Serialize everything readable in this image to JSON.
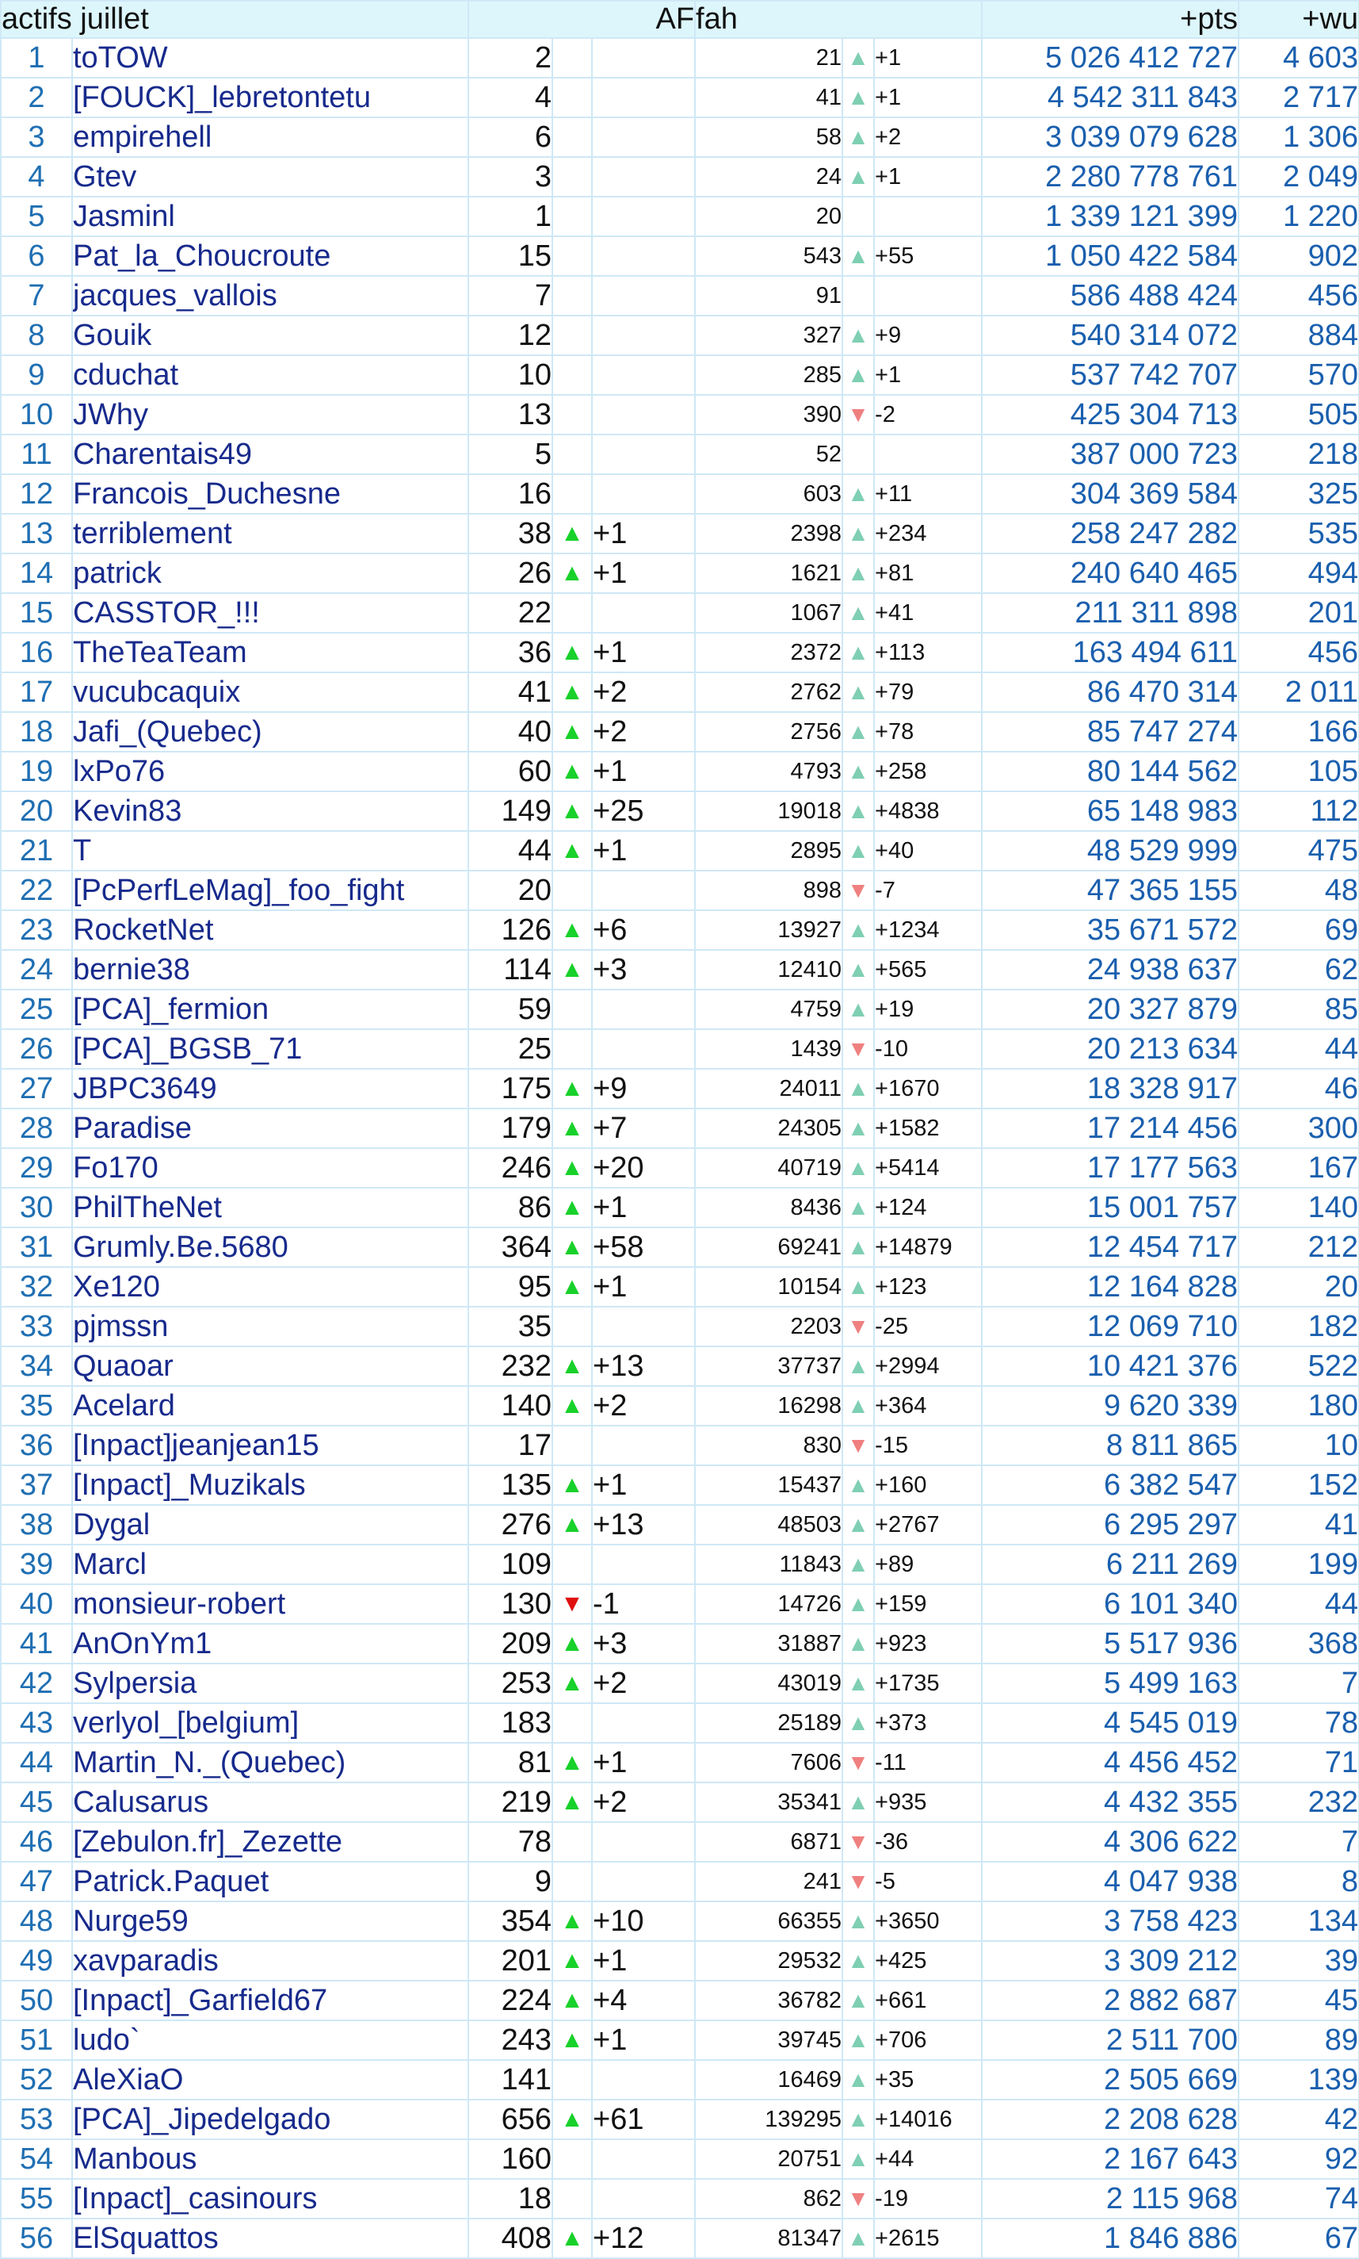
{
  "header": {
    "title": "actifs juillet",
    "af": "AF",
    "fah": "fah",
    "pts": "+pts",
    "wu": "+wu"
  },
  "icons": {
    "up": "triangle-up-icon",
    "down": "triangle-down-icon"
  },
  "colors": {
    "up_big": "#18d12a",
    "down_big": "#e01010",
    "up_small": "#7fcfb3",
    "down_small": "#f08080",
    "header_bg": "#ddf6fb",
    "name_text": "#172a8c",
    "points_text": "#1a5fae"
  },
  "rows": [
    {
      "rank": "1",
      "name": "toTOW",
      "af": "2",
      "af_arrow": "",
      "af_delta": "",
      "fah": "21",
      "fah_arrow": "up",
      "fah_delta": "+1",
      "pts": "5 026 412 727",
      "wu": "4 603"
    },
    {
      "rank": "2",
      "name": "[FOUCK]_lebretontetu",
      "af": "4",
      "af_arrow": "",
      "af_delta": "",
      "fah": "41",
      "fah_arrow": "up",
      "fah_delta": "+1",
      "pts": "4 542 311 843",
      "wu": "2 717"
    },
    {
      "rank": "3",
      "name": "empirehell",
      "af": "6",
      "af_arrow": "",
      "af_delta": "",
      "fah": "58",
      "fah_arrow": "up",
      "fah_delta": "+2",
      "pts": "3 039 079 628",
      "wu": "1 306"
    },
    {
      "rank": "4",
      "name": "Gtev",
      "af": "3",
      "af_arrow": "",
      "af_delta": "",
      "fah": "24",
      "fah_arrow": "up",
      "fah_delta": "+1",
      "pts": "2 280 778 761",
      "wu": "2 049"
    },
    {
      "rank": "5",
      "name": "Jasminl",
      "af": "1",
      "af_arrow": "",
      "af_delta": "",
      "fah": "20",
      "fah_arrow": "",
      "fah_delta": "",
      "pts": "1 339 121 399",
      "wu": "1 220"
    },
    {
      "rank": "6",
      "name": "Pat_la_Choucroute",
      "af": "15",
      "af_arrow": "",
      "af_delta": "",
      "fah": "543",
      "fah_arrow": "up",
      "fah_delta": "+55",
      "pts": "1 050 422 584",
      "wu": "902"
    },
    {
      "rank": "7",
      "name": "jacques_vallois",
      "af": "7",
      "af_arrow": "",
      "af_delta": "",
      "fah": "91",
      "fah_arrow": "",
      "fah_delta": "",
      "pts": "586 488 424",
      "wu": "456"
    },
    {
      "rank": "8",
      "name": "Gouik",
      "af": "12",
      "af_arrow": "",
      "af_delta": "",
      "fah": "327",
      "fah_arrow": "up",
      "fah_delta": "+9",
      "pts": "540 314 072",
      "wu": "884"
    },
    {
      "rank": "9",
      "name": "cduchat",
      "af": "10",
      "af_arrow": "",
      "af_delta": "",
      "fah": "285",
      "fah_arrow": "up",
      "fah_delta": "+1",
      "pts": "537 742 707",
      "wu": "570"
    },
    {
      "rank": "10",
      "name": "JWhy",
      "af": "13",
      "af_arrow": "",
      "af_delta": "",
      "fah": "390",
      "fah_arrow": "down",
      "fah_delta": "-2",
      "pts": "425 304 713",
      "wu": "505"
    },
    {
      "rank": "11",
      "name": "Charentais49",
      "af": "5",
      "af_arrow": "",
      "af_delta": "",
      "fah": "52",
      "fah_arrow": "",
      "fah_delta": "",
      "pts": "387 000 723",
      "wu": "218"
    },
    {
      "rank": "12",
      "name": "Francois_Duchesne",
      "af": "16",
      "af_arrow": "",
      "af_delta": "",
      "fah": "603",
      "fah_arrow": "up",
      "fah_delta": "+11",
      "pts": "304 369 584",
      "wu": "325"
    },
    {
      "rank": "13",
      "name": "terriblement",
      "af": "38",
      "af_arrow": "up",
      "af_delta": "+1",
      "fah": "2398",
      "fah_arrow": "up",
      "fah_delta": "+234",
      "pts": "258 247 282",
      "wu": "535"
    },
    {
      "rank": "14",
      "name": "patrick",
      "af": "26",
      "af_arrow": "up",
      "af_delta": "+1",
      "fah": "1621",
      "fah_arrow": "up",
      "fah_delta": "+81",
      "pts": "240 640 465",
      "wu": "494"
    },
    {
      "rank": "15",
      "name": "CASSTOR_!!!",
      "af": "22",
      "af_arrow": "",
      "af_delta": "",
      "fah": "1067",
      "fah_arrow": "up",
      "fah_delta": "+41",
      "pts": "211 311 898",
      "wu": "201"
    },
    {
      "rank": "16",
      "name": "TheTeaTeam",
      "af": "36",
      "af_arrow": "up",
      "af_delta": "+1",
      "fah": "2372",
      "fah_arrow": "up",
      "fah_delta": "+113",
      "pts": "163 494 611",
      "wu": "456"
    },
    {
      "rank": "17",
      "name": "vucubcaquix",
      "af": "41",
      "af_arrow": "up",
      "af_delta": "+2",
      "fah": "2762",
      "fah_arrow": "up",
      "fah_delta": "+79",
      "pts": "86 470 314",
      "wu": "2 011"
    },
    {
      "rank": "18",
      "name": "Jafi_(Quebec)",
      "af": "40",
      "af_arrow": "up",
      "af_delta": "+2",
      "fah": "2756",
      "fah_arrow": "up",
      "fah_delta": "+78",
      "pts": "85 747 274",
      "wu": "166"
    },
    {
      "rank": "19",
      "name": "lxPo76",
      "af": "60",
      "af_arrow": "up",
      "af_delta": "+1",
      "fah": "4793",
      "fah_arrow": "up",
      "fah_delta": "+258",
      "pts": "80 144 562",
      "wu": "105"
    },
    {
      "rank": "20",
      "name": "Kevin83",
      "af": "149",
      "af_arrow": "up",
      "af_delta": "+25",
      "fah": "19018",
      "fah_arrow": "up",
      "fah_delta": "+4838",
      "pts": "65 148 983",
      "wu": "112"
    },
    {
      "rank": "21",
      "name": "T",
      "af": "44",
      "af_arrow": "up",
      "af_delta": "+1",
      "fah": "2895",
      "fah_arrow": "up",
      "fah_delta": "+40",
      "pts": "48 529 999",
      "wu": "475"
    },
    {
      "rank": "22",
      "name": "[PcPerfLeMag]_foo_fight",
      "af": "20",
      "af_arrow": "",
      "af_delta": "",
      "fah": "898",
      "fah_arrow": "down",
      "fah_delta": "-7",
      "pts": "47 365 155",
      "wu": "48"
    },
    {
      "rank": "23",
      "name": "RocketNet",
      "af": "126",
      "af_arrow": "up",
      "af_delta": "+6",
      "fah": "13927",
      "fah_arrow": "up",
      "fah_delta": "+1234",
      "pts": "35 671 572",
      "wu": "69"
    },
    {
      "rank": "24",
      "name": "bernie38",
      "af": "114",
      "af_arrow": "up",
      "af_delta": "+3",
      "fah": "12410",
      "fah_arrow": "up",
      "fah_delta": "+565",
      "pts": "24 938 637",
      "wu": "62"
    },
    {
      "rank": "25",
      "name": "[PCA]_fermion",
      "af": "59",
      "af_arrow": "",
      "af_delta": "",
      "fah": "4759",
      "fah_arrow": "up",
      "fah_delta": "+19",
      "pts": "20 327 879",
      "wu": "85"
    },
    {
      "rank": "26",
      "name": "[PCA]_BGSB_71",
      "af": "25",
      "af_arrow": "",
      "af_delta": "",
      "fah": "1439",
      "fah_arrow": "down",
      "fah_delta": "-10",
      "pts": "20 213 634",
      "wu": "44"
    },
    {
      "rank": "27",
      "name": "JBPC3649",
      "af": "175",
      "af_arrow": "up",
      "af_delta": "+9",
      "fah": "24011",
      "fah_arrow": "up",
      "fah_delta": "+1670",
      "pts": "18 328 917",
      "wu": "46"
    },
    {
      "rank": "28",
      "name": "Paradise",
      "af": "179",
      "af_arrow": "up",
      "af_delta": "+7",
      "fah": "24305",
      "fah_arrow": "up",
      "fah_delta": "+1582",
      "pts": "17 214 456",
      "wu": "300"
    },
    {
      "rank": "29",
      "name": "Fo170",
      "af": "246",
      "af_arrow": "up",
      "af_delta": "+20",
      "fah": "40719",
      "fah_arrow": "up",
      "fah_delta": "+5414",
      "pts": "17 177 563",
      "wu": "167"
    },
    {
      "rank": "30",
      "name": "PhilTheNet",
      "af": "86",
      "af_arrow": "up",
      "af_delta": "+1",
      "fah": "8436",
      "fah_arrow": "up",
      "fah_delta": "+124",
      "pts": "15 001 757",
      "wu": "140"
    },
    {
      "rank": "31",
      "name": "Grumly.Be.5680",
      "af": "364",
      "af_arrow": "up",
      "af_delta": "+58",
      "fah": "69241",
      "fah_arrow": "up",
      "fah_delta": "+14879",
      "pts": "12 454 717",
      "wu": "212"
    },
    {
      "rank": "32",
      "name": "Xe120",
      "af": "95",
      "af_arrow": "up",
      "af_delta": "+1",
      "fah": "10154",
      "fah_arrow": "up",
      "fah_delta": "+123",
      "pts": "12 164 828",
      "wu": "20"
    },
    {
      "rank": "33",
      "name": "pjmssn",
      "af": "35",
      "af_arrow": "",
      "af_delta": "",
      "fah": "2203",
      "fah_arrow": "down",
      "fah_delta": "-25",
      "pts": "12 069 710",
      "wu": "182"
    },
    {
      "rank": "34",
      "name": "Quaoar",
      "af": "232",
      "af_arrow": "up",
      "af_delta": "+13",
      "fah": "37737",
      "fah_arrow": "up",
      "fah_delta": "+2994",
      "pts": "10 421 376",
      "wu": "522"
    },
    {
      "rank": "35",
      "name": "Acelard",
      "af": "140",
      "af_arrow": "up",
      "af_delta": "+2",
      "fah": "16298",
      "fah_arrow": "up",
      "fah_delta": "+364",
      "pts": "9 620 339",
      "wu": "180"
    },
    {
      "rank": "36",
      "name": "[Inpact]jeanjean15",
      "af": "17",
      "af_arrow": "",
      "af_delta": "",
      "fah": "830",
      "fah_arrow": "down",
      "fah_delta": "-15",
      "pts": "8 811 865",
      "wu": "10"
    },
    {
      "rank": "37",
      "name": "[Inpact]_Muzikals",
      "af": "135",
      "af_arrow": "up",
      "af_delta": "+1",
      "fah": "15437",
      "fah_arrow": "up",
      "fah_delta": "+160",
      "pts": "6 382 547",
      "wu": "152"
    },
    {
      "rank": "38",
      "name": "Dygal",
      "af": "276",
      "af_arrow": "up",
      "af_delta": "+13",
      "fah": "48503",
      "fah_arrow": "up",
      "fah_delta": "+2767",
      "pts": "6 295 297",
      "wu": "41"
    },
    {
      "rank": "39",
      "name": "Marcl",
      "af": "109",
      "af_arrow": "",
      "af_delta": "",
      "fah": "11843",
      "fah_arrow": "up",
      "fah_delta": "+89",
      "pts": "6 211 269",
      "wu": "199"
    },
    {
      "rank": "40",
      "name": "monsieur-robert",
      "af": "130",
      "af_arrow": "down",
      "af_delta": "-1",
      "fah": "14726",
      "fah_arrow": "up",
      "fah_delta": "+159",
      "pts": "6 101 340",
      "wu": "44"
    },
    {
      "rank": "41",
      "name": "AnOnYm1",
      "af": "209",
      "af_arrow": "up",
      "af_delta": "+3",
      "fah": "31887",
      "fah_arrow": "up",
      "fah_delta": "+923",
      "pts": "5 517 936",
      "wu": "368"
    },
    {
      "rank": "42",
      "name": "Sylpersia",
      "af": "253",
      "af_arrow": "up",
      "af_delta": "+2",
      "fah": "43019",
      "fah_arrow": "up",
      "fah_delta": "+1735",
      "pts": "5 499 163",
      "wu": "7"
    },
    {
      "rank": "43",
      "name": "verlyol_[belgium]",
      "af": "183",
      "af_arrow": "",
      "af_delta": "",
      "fah": "25189",
      "fah_arrow": "up",
      "fah_delta": "+373",
      "pts": "4 545 019",
      "wu": "78"
    },
    {
      "rank": "44",
      "name": "Martin_N._(Quebec)",
      "af": "81",
      "af_arrow": "up",
      "af_delta": "+1",
      "fah": "7606",
      "fah_arrow": "down",
      "fah_delta": "-11",
      "pts": "4 456 452",
      "wu": "71"
    },
    {
      "rank": "45",
      "name": "Calusarus",
      "af": "219",
      "af_arrow": "up",
      "af_delta": "+2",
      "fah": "35341",
      "fah_arrow": "up",
      "fah_delta": "+935",
      "pts": "4 432 355",
      "wu": "232"
    },
    {
      "rank": "46",
      "name": "[Zebulon.fr]_Zezette",
      "af": "78",
      "af_arrow": "",
      "af_delta": "",
      "fah": "6871",
      "fah_arrow": "down",
      "fah_delta": "-36",
      "pts": "4 306 622",
      "wu": "7"
    },
    {
      "rank": "47",
      "name": "Patrick.Paquet",
      "af": "9",
      "af_arrow": "",
      "af_delta": "",
      "fah": "241",
      "fah_arrow": "down",
      "fah_delta": "-5",
      "pts": "4 047 938",
      "wu": "8"
    },
    {
      "rank": "48",
      "name": "Nurge59",
      "af": "354",
      "af_arrow": "up",
      "af_delta": "+10",
      "fah": "66355",
      "fah_arrow": "up",
      "fah_delta": "+3650",
      "pts": "3 758 423",
      "wu": "134"
    },
    {
      "rank": "49",
      "name": "xavparadis",
      "af": "201",
      "af_arrow": "up",
      "af_delta": "+1",
      "fah": "29532",
      "fah_arrow": "up",
      "fah_delta": "+425",
      "pts": "3 309 212",
      "wu": "39"
    },
    {
      "rank": "50",
      "name": "[Inpact]_Garfield67",
      "af": "224",
      "af_arrow": "up",
      "af_delta": "+4",
      "fah": "36782",
      "fah_arrow": "up",
      "fah_delta": "+661",
      "pts": "2 882 687",
      "wu": "45"
    },
    {
      "rank": "51",
      "name": "ludo`",
      "af": "243",
      "af_arrow": "up",
      "af_delta": "+1",
      "fah": "39745",
      "fah_arrow": "up",
      "fah_delta": "+706",
      "pts": "2 511 700",
      "wu": "89"
    },
    {
      "rank": "52",
      "name": "AleXiaO",
      "af": "141",
      "af_arrow": "",
      "af_delta": "",
      "fah": "16469",
      "fah_arrow": "up",
      "fah_delta": "+35",
      "pts": "2 505 669",
      "wu": "139"
    },
    {
      "rank": "53",
      "name": "[PCA]_Jipedelgado",
      "af": "656",
      "af_arrow": "up",
      "af_delta": "+61",
      "fah": "139295",
      "fah_arrow": "up",
      "fah_delta": "+14016",
      "pts": "2 208 628",
      "wu": "42"
    },
    {
      "rank": "54",
      "name": "Manbous",
      "af": "160",
      "af_arrow": "",
      "af_delta": "",
      "fah": "20751",
      "fah_arrow": "up",
      "fah_delta": "+44",
      "pts": "2 167 643",
      "wu": "92"
    },
    {
      "rank": "55",
      "name": "[Inpact]_casinours",
      "af": "18",
      "af_arrow": "",
      "af_delta": "",
      "fah": "862",
      "fah_arrow": "down",
      "fah_delta": "-19",
      "pts": "2 115 968",
      "wu": "74"
    },
    {
      "rank": "56",
      "name": "ElSquattos",
      "af": "408",
      "af_arrow": "up",
      "af_delta": "+12",
      "fah": "81347",
      "fah_arrow": "up",
      "fah_delta": "+2615",
      "pts": "1 846 886",
      "wu": "67"
    }
  ]
}
